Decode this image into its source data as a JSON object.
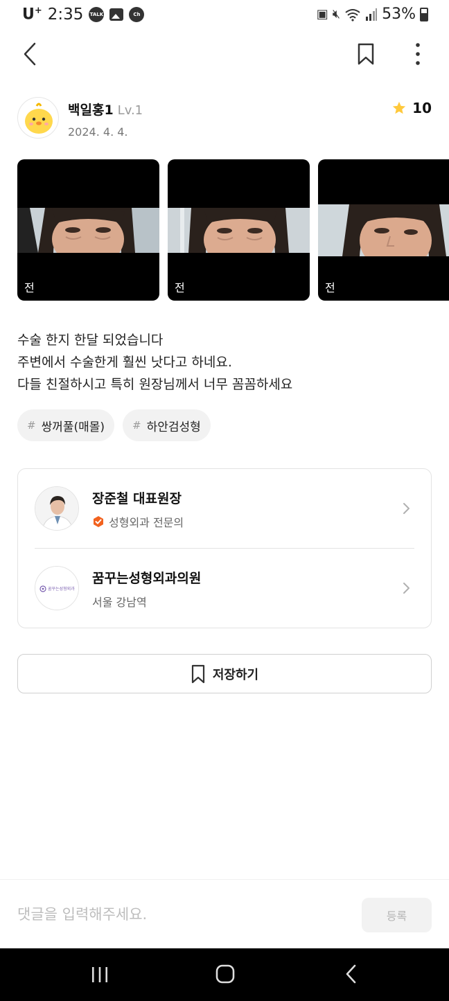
{
  "status_bar": {
    "carrier": "U",
    "carrier_sup": "+",
    "time": "2:35",
    "notif_icons": [
      "talk-icon",
      "gallery-icon",
      "channel-icon"
    ],
    "talk_badge": "TALK",
    "channel_badge": "Ch",
    "battery_percent": "53%"
  },
  "author": {
    "name": "백일홍1",
    "level": "Lv.1",
    "date": "2024. 4. 4.",
    "rating": "10"
  },
  "gallery": {
    "images": [
      {
        "label": "전"
      },
      {
        "label": "전"
      },
      {
        "label": "전"
      }
    ]
  },
  "post": {
    "lines": [
      "수술 한지 한달 되었습니다",
      "주변에서 수술한게 훨씬 낫다고 하네요.",
      "다들 친절하시고 특히 원장님께서 너무 꼼꼼하세요"
    ]
  },
  "tags": [
    {
      "hash": "#",
      "label": "쌍꺼풀(매몰)"
    },
    {
      "hash": "#",
      "label": "하안검성형"
    }
  ],
  "doctor": {
    "name": "장준철 대표원장",
    "specialty": "성형외과 전문의"
  },
  "clinic": {
    "name": "꿈꾸는성형외과의원",
    "location": "서울 강남역",
    "logo_text": "꿈꾸는성형외과"
  },
  "actions": {
    "save_label": "저장하기"
  },
  "comment": {
    "placeholder": "댓글을 입력해주세요.",
    "submit_label": "등록"
  },
  "colors": {
    "accent_orange": "#f2621f",
    "star": "#ffc93c",
    "text_primary": "#111111",
    "text_secondary": "#777777"
  }
}
